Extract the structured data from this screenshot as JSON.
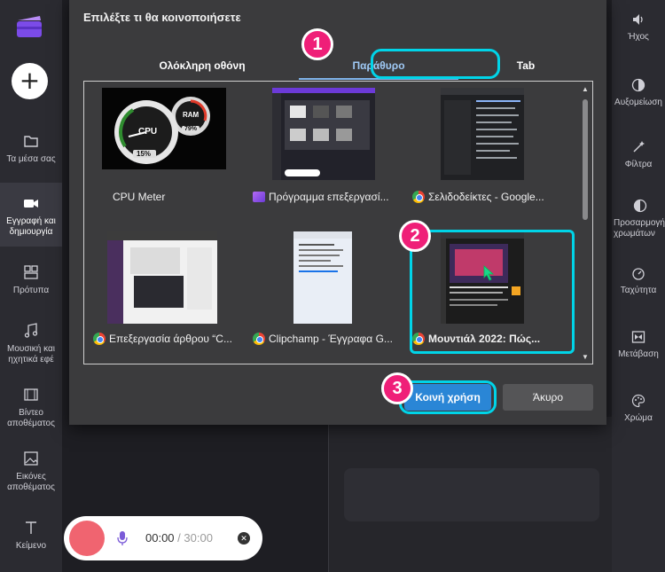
{
  "left_nav": {
    "items": [
      {
        "label": "Τα μέσα σας",
        "icon": "folder-icon"
      },
      {
        "label": "Εγγραφή και δημιουργία",
        "icon": "camera-icon",
        "active": true
      },
      {
        "label": "Πρότυπα",
        "icon": "templates-icon"
      },
      {
        "label": "Μουσική και ηχητικά εφέ",
        "icon": "music-icon"
      },
      {
        "label": "Βίντεο αποθέματος",
        "icon": "film-icon"
      },
      {
        "label": "Εικόνες αποθέματος",
        "icon": "image-icon"
      },
      {
        "label": "Κείμενο",
        "icon": "text-icon"
      }
    ]
  },
  "right_nav": {
    "items": [
      {
        "label": "Ήχος",
        "icon": "speaker-icon"
      },
      {
        "label": "Αυξομείωση",
        "icon": "fade-icon"
      },
      {
        "label": "Φίλτρα",
        "icon": "filter-wand-icon"
      },
      {
        "label": "Προσαρμογή χρωμάτων",
        "icon": "contrast-icon"
      },
      {
        "label": "Ταχύτητα",
        "icon": "speed-icon"
      },
      {
        "label": "Μετάβαση",
        "icon": "transition-icon"
      },
      {
        "label": "Χρώμα",
        "icon": "palette-icon"
      }
    ]
  },
  "dialog": {
    "title": "Επιλέξτε τι θα κοινοποιήσετε",
    "tabs": [
      {
        "label": "Ολόκληρη οθόνη",
        "selected": false
      },
      {
        "label": "Παράθυρο",
        "selected": true
      },
      {
        "label": "Tab",
        "selected": false
      }
    ],
    "windows": [
      {
        "label": "CPU Meter",
        "icon": "none",
        "gauge_cpu": "CPU",
        "gauge_ram": "RAM",
        "cpu_pct": "15%",
        "ram_pct": "79%"
      },
      {
        "label": "Πρόγραμμα επεξεργασί...",
        "icon": "clipchamp-icon"
      },
      {
        "label": "Σελιδοδείκτες - Google...",
        "icon": "chrome-icon"
      },
      {
        "label": "Επεξεργασία άρθρου “C...",
        "icon": "chrome-icon"
      },
      {
        "label": "Clipchamp - Έγγραφα G...",
        "icon": "chrome-icon"
      },
      {
        "label": "Μουντιάλ 2022: Πώς...",
        "icon": "chrome-icon",
        "selected": true
      }
    ],
    "share_label": "Κοινή χρήση",
    "cancel_label": "Άκυρο"
  },
  "badges": [
    "1",
    "2",
    "3"
  ],
  "recorder": {
    "elapsed": "00:00",
    "separator": "/",
    "total": "30:00"
  },
  "colors": {
    "highlight": "#00d4e8",
    "badge": "#ef1f78",
    "accent_tab": "#9fc9f5",
    "share_button": "#2a86d6",
    "record": "#f06470"
  }
}
